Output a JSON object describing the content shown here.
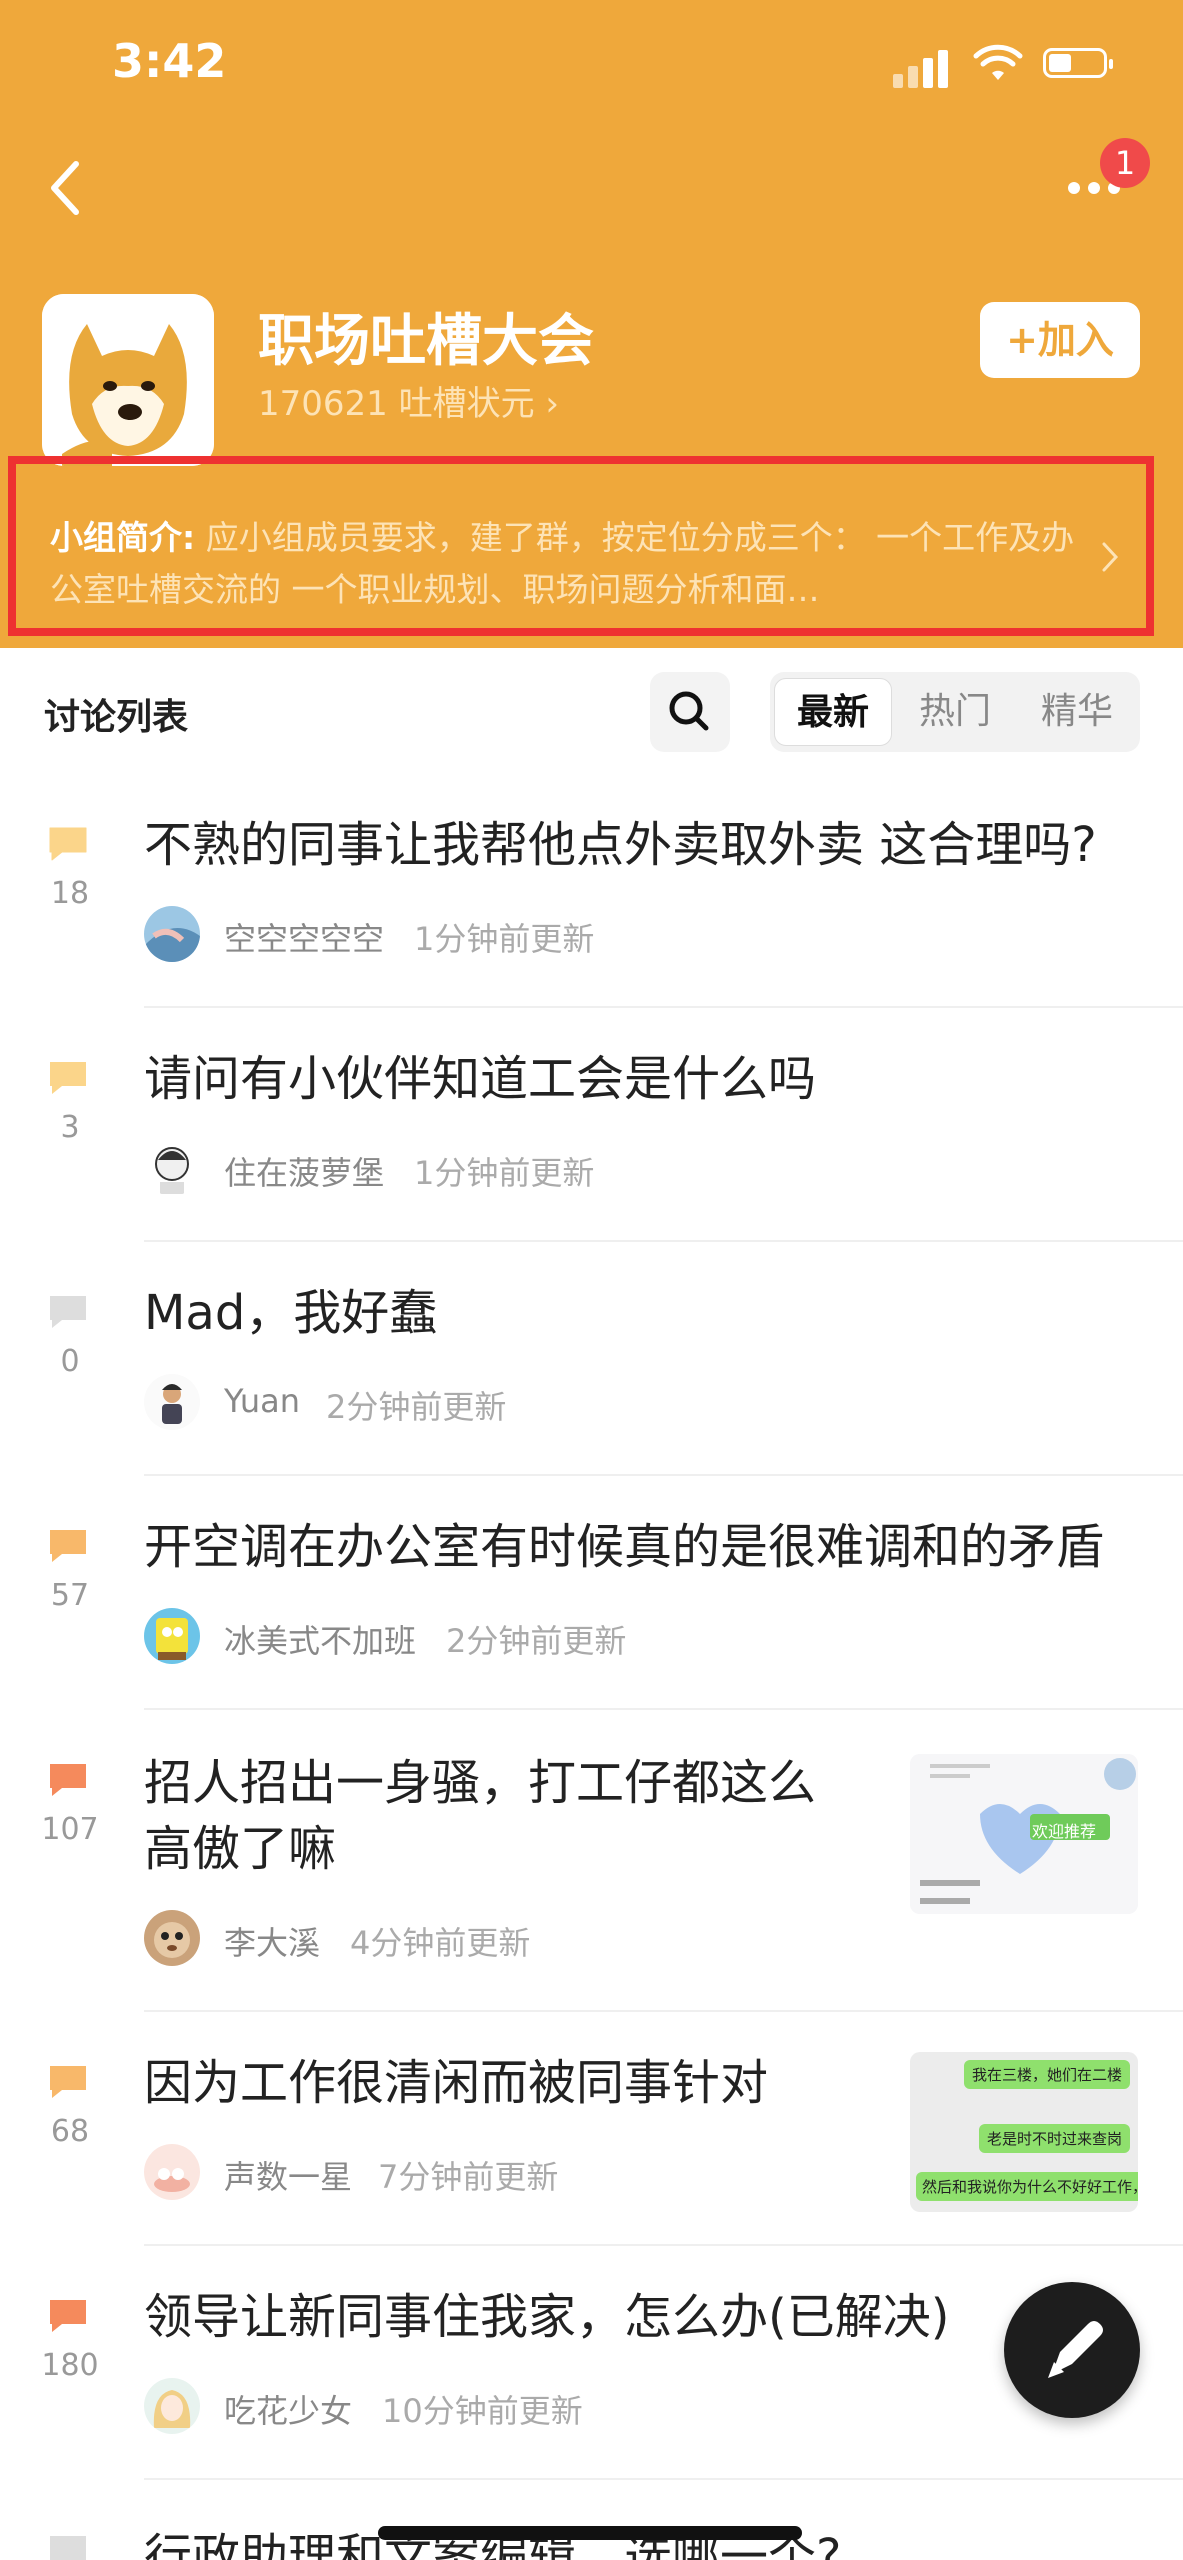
{
  "status_bar": {
    "time": "3:42"
  },
  "header": {
    "notification_count": "1",
    "group_name": "职场吐槽大会",
    "group_stats": "170621 吐槽状元 ",
    "join_label": "+加入",
    "intro_label": "小组简介:",
    "intro_text": " 应小组成员要求，建了群，按定位分成三个： 一个工作及办公室吐槽交流的 一个职业规划、职场问题分析和面…",
    "colors": {
      "header_bg": "#efa83b",
      "highlight_border": "#ee3131"
    }
  },
  "list": {
    "title": "讨论列表",
    "tabs": [
      "最新",
      "热门",
      "精华"
    ],
    "active_tab": "最新"
  },
  "posts": [
    {
      "count": "18",
      "title": "不熟的同事让我帮他点外卖取外卖 这合理吗?",
      "user": "空空空空空",
      "time": "1分钟前更新",
      "icon_color": "#fbd58a"
    },
    {
      "count": "3",
      "title": "请问有小伙伴知道工会是什么吗",
      "user": "住在菠萝堡",
      "time": "1分钟前更新",
      "icon_color": "#fbd58a"
    },
    {
      "count": "0",
      "title": "Mad，我好蠢",
      "user": "Yuan",
      "time": "2分钟前更新",
      "icon_color": "#dddddd"
    },
    {
      "count": "57",
      "title": "开空调在办公室有时候真的是很难调和的矛盾",
      "user": "冰美式不加班",
      "time": "2分钟前更新",
      "icon_color": "#f8b86a"
    },
    {
      "count": "107",
      "title_lines": [
        "招人招出一身骚，打工仔都这么",
        "高傲了嘛"
      ],
      "user": "李大溪",
      "time": "4分钟前更新",
      "icon_color": "#f58a5c",
      "thumb_text": "欢迎推荐"
    },
    {
      "count": "68",
      "title": "因为工作很清闲而被同事针对",
      "user": "声数一星",
      "time": "7分钟前更新",
      "icon_color": "#f8b86a",
      "thumb_lines": [
        "我在三楼，她们在二楼",
        "老是时不时过来查岗",
        "然后和我说你为什么不好好工作，"
      ]
    },
    {
      "count": "180",
      "title": "领导让新同事住我家，怎么办(已解决)",
      "user": "吃花少女",
      "time": "10分钟前更新",
      "icon_color": "#f58a5c"
    },
    {
      "title": "行政助理和文案编辑，选哪一个?",
      "icon_color": "#dddddd"
    }
  ]
}
